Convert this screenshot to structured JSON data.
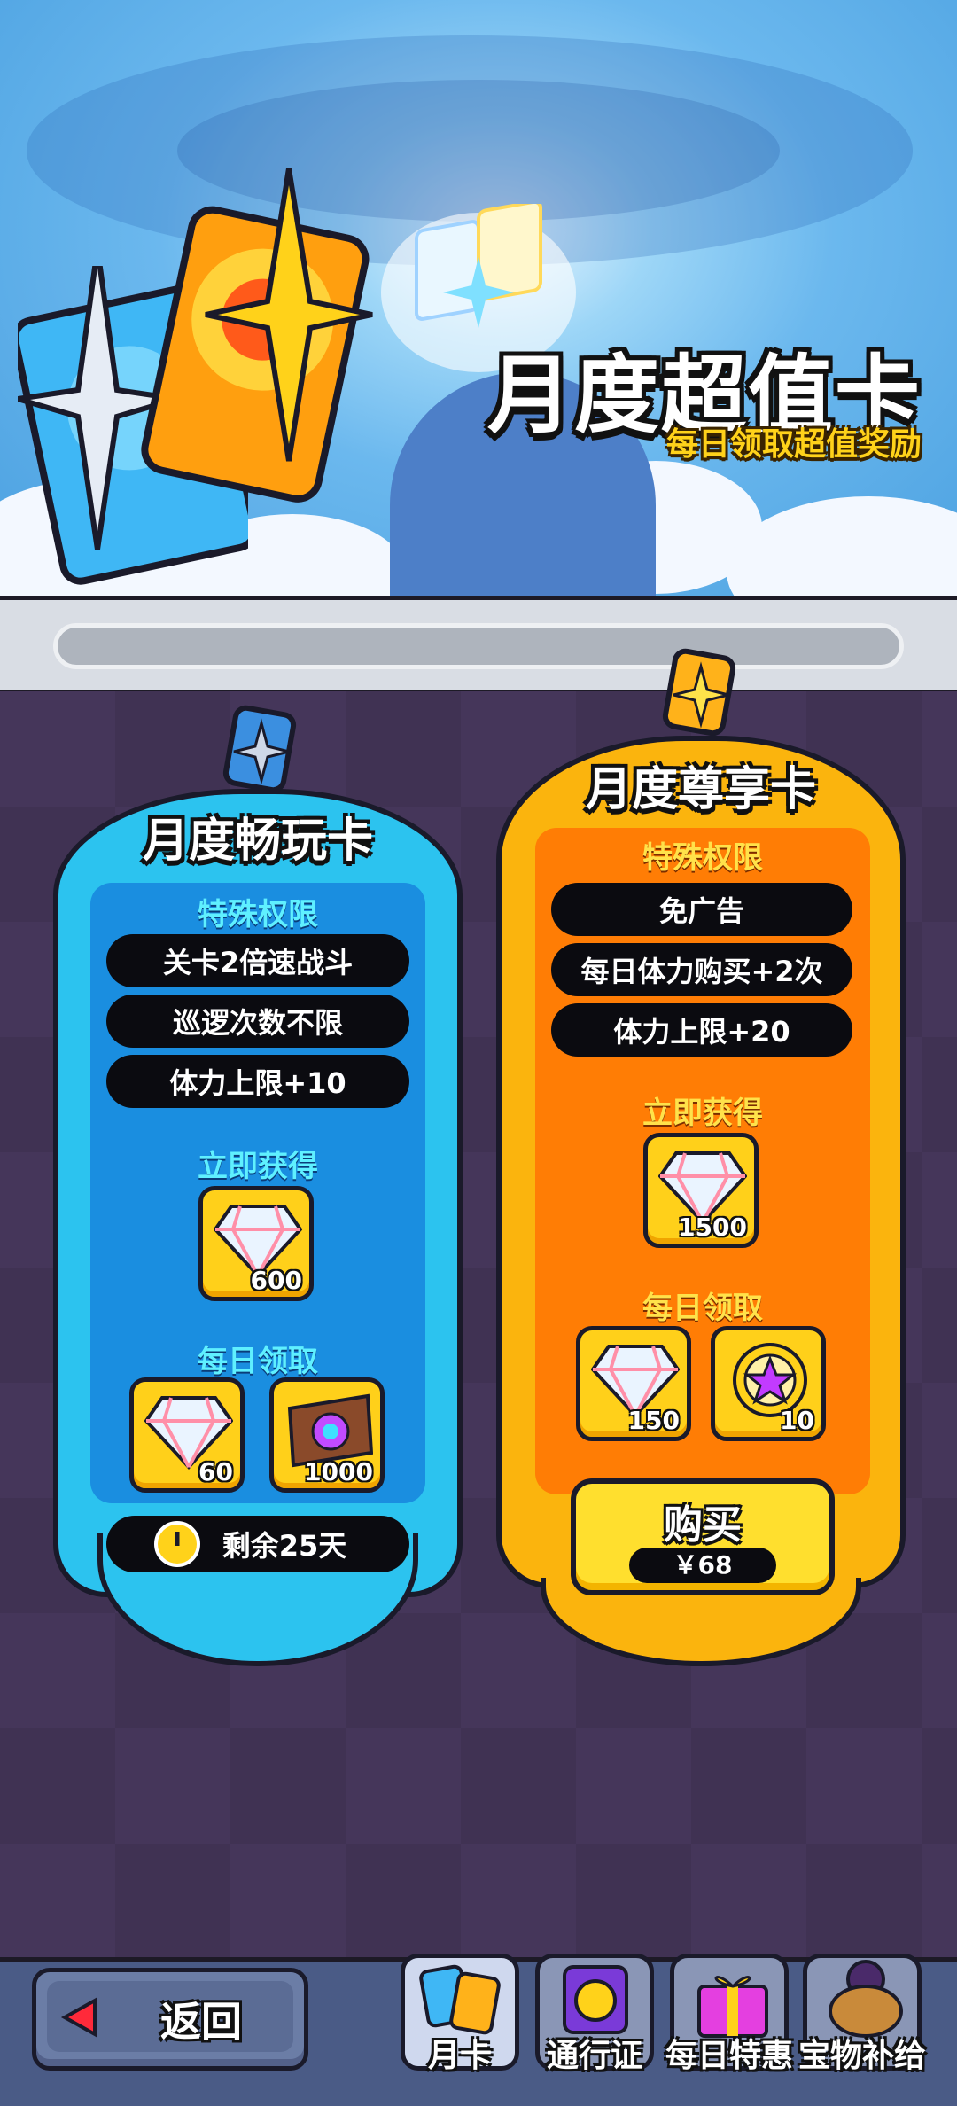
{
  "banner": {
    "title": "月度超值卡",
    "subtitle": "每日领取超值奖励"
  },
  "card_play": {
    "title": "月度畅玩卡",
    "privileges_label": "特殊权限",
    "privileges": [
      "关卡2倍速战斗",
      "巡逻次数不限",
      "体力上限+10"
    ],
    "instant_label": "立即获得",
    "instant_items": [
      {
        "icon": "diamond-icon",
        "qty": "600"
      }
    ],
    "daily_label": "每日领取",
    "daily_items": [
      {
        "icon": "diamond-icon",
        "qty": "60"
      },
      {
        "icon": "ticket-icon",
        "qty": "1000"
      }
    ],
    "remaining": "剩余25天"
  },
  "card_vip": {
    "title": "月度尊享卡",
    "privileges_label": "特殊权限",
    "privileges": [
      "免广告",
      "每日体力购买+2次",
      "体力上限+20"
    ],
    "instant_label": "立即获得",
    "instant_items": [
      {
        "icon": "diamond-icon",
        "qty": "1500"
      }
    ],
    "daily_label": "每日领取",
    "daily_items": [
      {
        "icon": "diamond-icon",
        "qty": "150"
      },
      {
        "icon": "star-coin-icon",
        "qty": "10"
      }
    ],
    "buy_label": "购买",
    "price": "￥68"
  },
  "nav": {
    "back_label": "返回",
    "tabs": [
      {
        "label": "月卡",
        "active": true,
        "icon": "monthly-card-icon"
      },
      {
        "label": "通行证",
        "active": false,
        "icon": "pass-icon"
      },
      {
        "label": "每日特惠",
        "active": false,
        "icon": "gift-icon"
      },
      {
        "label": "宝物补给",
        "active": false,
        "icon": "treasure-pot-icon"
      }
    ]
  },
  "colors": {
    "play_card": "#2cc3ef",
    "vip_card": "#fbb40d",
    "accent_yellow": "#ffd21a"
  }
}
